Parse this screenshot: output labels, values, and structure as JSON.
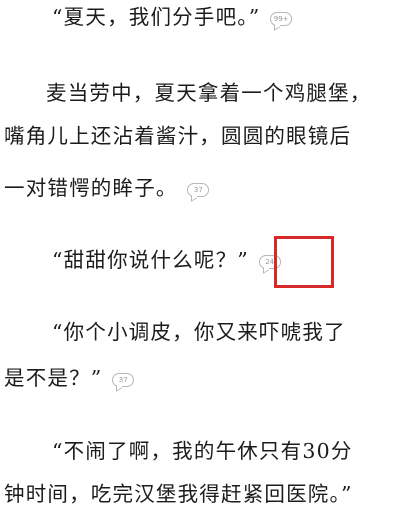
{
  "paragraphs": [
    {
      "lines": [
        "“夏天，我们分手吧。”"
      ],
      "comment_count": "99+"
    },
    {
      "lines": [
        "麦当劳中，夏天拿着一个鸡腿堡，",
        "嘴角儿上还沾着酱汁，圆圆的眼镜后",
        "一对错愕的眸子。"
      ],
      "comment_count": "37"
    },
    {
      "lines": [
        "“甜甜你说什么呢？”"
      ],
      "comment_count": "24"
    },
    {
      "lines": [
        "“你个小调皮，你又来吓唬我了",
        "是不是？”"
      ],
      "comment_count": "37"
    },
    {
      "lines": [
        "“不闹了啊，我的午休只有30分",
        "钟时间，吃完汉堡我得赶紧回医院。”"
      ]
    }
  ],
  "highlight": {
    "target": "comment-bubble-24",
    "color": "#d62a2a"
  }
}
